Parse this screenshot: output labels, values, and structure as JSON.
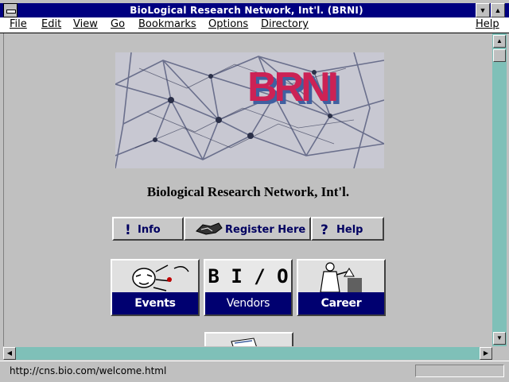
{
  "window": {
    "title": "BioLogical Research Network, Int'l. (BRNI)"
  },
  "menu": [
    "File",
    "Edit",
    "View",
    "Go",
    "Bookmarks",
    "Options",
    "Directory",
    "Help"
  ],
  "banner": {
    "logo_text": "BRNI"
  },
  "page": {
    "title": "Biological Research Network, Int'l."
  },
  "nav": {
    "info": "Info",
    "register": "Register Here",
    "help": "Help"
  },
  "tiles": {
    "events": "Events",
    "vendors": "Vendors",
    "career": "Career",
    "bio": "B I / O"
  },
  "status": {
    "url": "http://cns.bio.com/welcome.html"
  },
  "colors": {
    "titlebar": "#000080",
    "tile_band": "#000070",
    "logo_red": "#cc2255",
    "logo_blue": "#4060a0",
    "scroll_track": "#7fc0b8"
  }
}
